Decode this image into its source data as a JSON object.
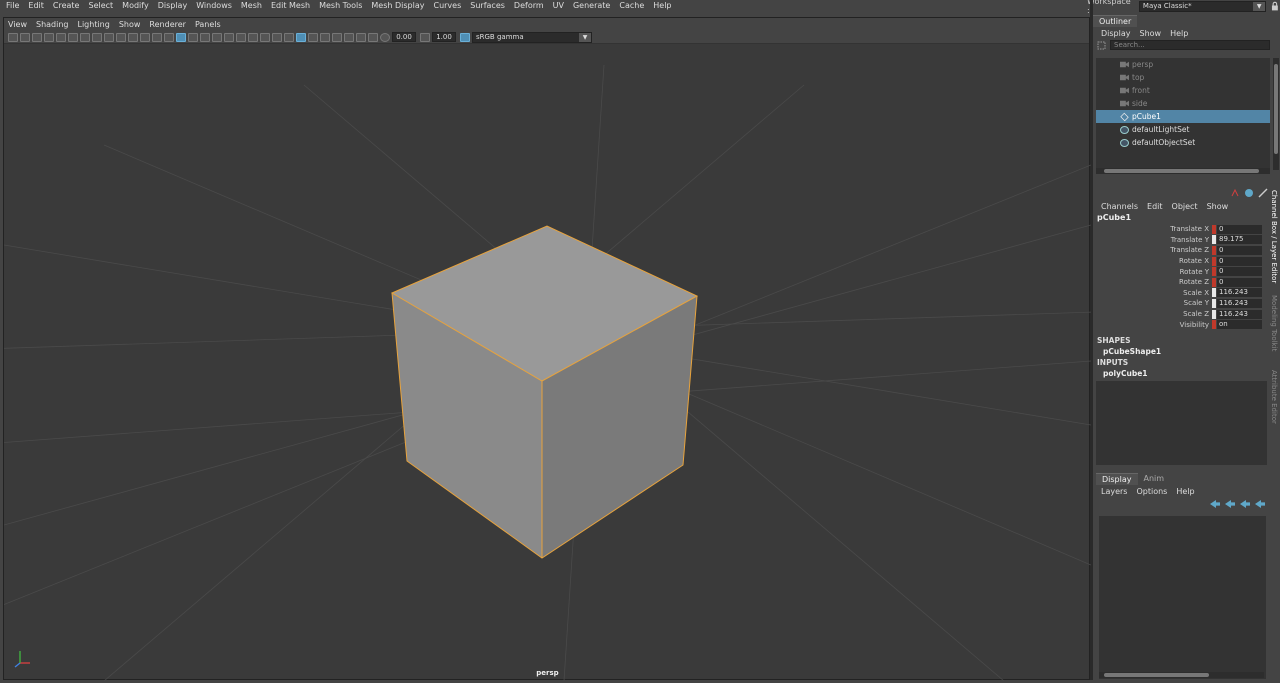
{
  "main_menu": [
    "File",
    "Edit",
    "Create",
    "Select",
    "Modify",
    "Display",
    "Windows",
    "Mesh",
    "Edit Mesh",
    "Mesh Tools",
    "Mesh Display",
    "Curves",
    "Surfaces",
    "Deform",
    "UV",
    "Generate",
    "Cache",
    "Help"
  ],
  "workspace": {
    "label": "Workspace :",
    "value": "Maya Classic*"
  },
  "panel_menu": [
    "View",
    "Shading",
    "Lighting",
    "Show",
    "Renderer",
    "Panels"
  ],
  "panel_toolbar": {
    "exposure": "0.00",
    "gamma": "1.00",
    "color_space": "sRGB gamma"
  },
  "viewport": {
    "camera_label": "persp"
  },
  "outliner": {
    "tab": "Outliner",
    "menu": [
      "Display",
      "Show",
      "Help"
    ],
    "search_placeholder": "Search...",
    "items": [
      {
        "label": "persp",
        "state": "dim",
        "icon": "camera-icon"
      },
      {
        "label": "top",
        "state": "dim",
        "icon": "camera-icon"
      },
      {
        "label": "front",
        "state": "dim",
        "icon": "camera-icon"
      },
      {
        "label": "side",
        "state": "dim",
        "icon": "camera-icon"
      },
      {
        "label": "pCube1",
        "state": "selected",
        "icon": "transform-icon"
      },
      {
        "label": "defaultLightSet",
        "state": "normal",
        "icon": "set-icon"
      },
      {
        "label": "defaultObjectSet",
        "state": "normal",
        "icon": "set-icon"
      }
    ]
  },
  "channel_box": {
    "menu": [
      "Channels",
      "Edit",
      "Object",
      "Show"
    ],
    "object": "pCube1",
    "attributes": [
      {
        "name": "Translate X",
        "value": "0"
      },
      {
        "name": "Translate Y",
        "value": "89.175"
      },
      {
        "name": "Translate Z",
        "value": "0"
      },
      {
        "name": "Rotate X",
        "value": "0"
      },
      {
        "name": "Rotate Y",
        "value": "0"
      },
      {
        "name": "Rotate Z",
        "value": "0"
      },
      {
        "name": "Scale X",
        "value": "116.243"
      },
      {
        "name": "Scale Y",
        "value": "116.243"
      },
      {
        "name": "Scale Z",
        "value": "116.243"
      },
      {
        "name": "Visibility",
        "value": "on"
      }
    ],
    "shapes_header": "SHAPES",
    "shape": "pCubeShape1",
    "inputs_header": "INPUTS",
    "input": "polyCube1"
  },
  "side_tabs": [
    "Channel Box / Layer Editor",
    "Modeling Toolkit",
    "Attribute Editor"
  ],
  "layer_editor": {
    "tabs": [
      "Display",
      "Anim"
    ],
    "menu": [
      "Layers",
      "Options",
      "Help"
    ]
  },
  "colors": {
    "selection": "#5285a6",
    "wire": "#e8a33c",
    "key": "#c0392b"
  }
}
